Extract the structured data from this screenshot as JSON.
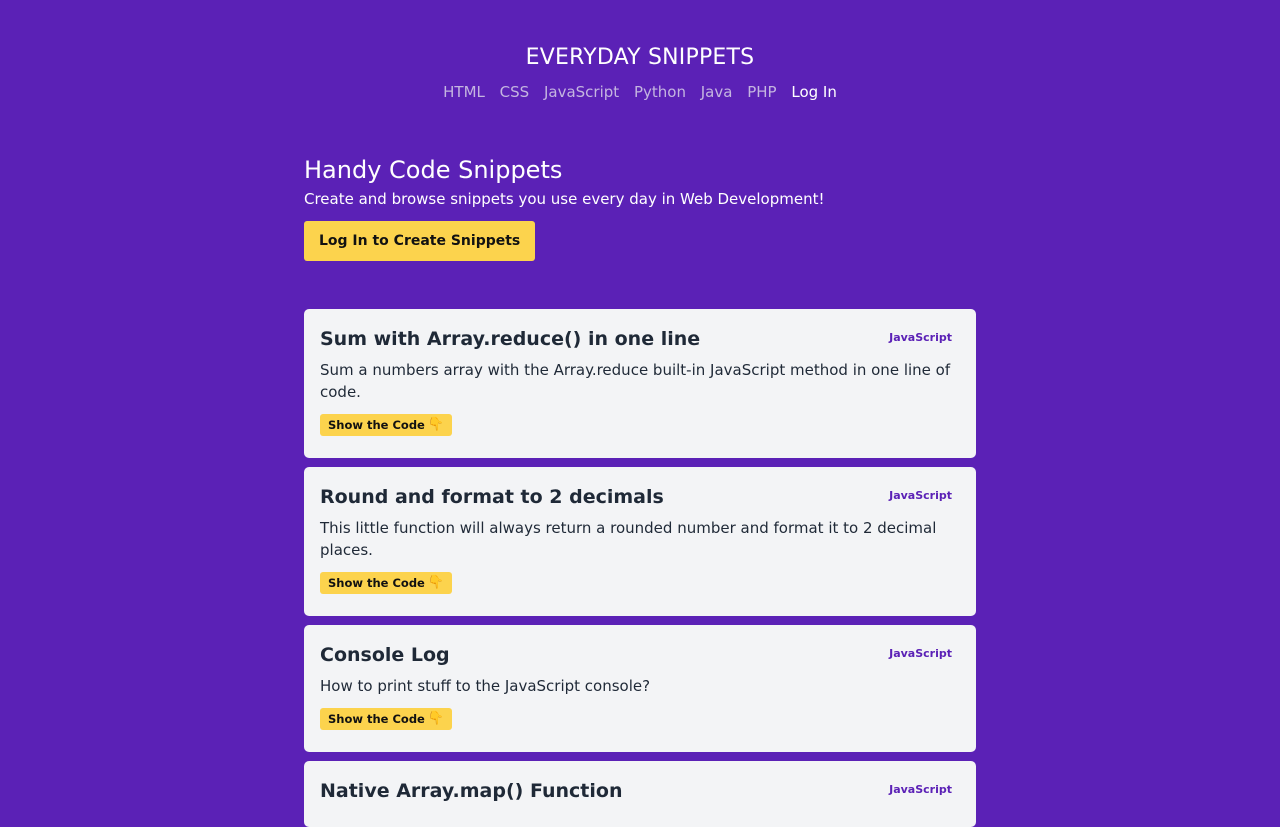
{
  "site": {
    "title": "EVERYDAY SNIPPETS"
  },
  "nav": {
    "items": [
      {
        "label": "HTML",
        "active": false
      },
      {
        "label": "CSS",
        "active": false
      },
      {
        "label": "JavaScript",
        "active": false
      },
      {
        "label": "Python",
        "active": false
      },
      {
        "label": "Java",
        "active": false
      },
      {
        "label": "PHP",
        "active": false
      },
      {
        "label": "Log In",
        "active": true
      }
    ]
  },
  "hero": {
    "heading": "Handy Code Snippets",
    "subheading": "Create and browse snippets you use every day in Web Development!",
    "cta_label": "Log In to Create Snippets"
  },
  "colors": {
    "background": "#5b21b6",
    "accent": "#fcd34d",
    "card": "#f3f4f6",
    "tag": "#5b21b6"
  },
  "snippets": [
    {
      "title": "Sum with Array.reduce() in one line",
      "tag": "JavaScript",
      "description": "Sum a numbers array with the Array.reduce built-in JavaScript method in one line of code.",
      "button_label": "Show the Code",
      "button_icon": "pointing-hand-icon"
    },
    {
      "title": "Round and format to 2 decimals",
      "tag": "JavaScript",
      "description": "This little function will always return a rounded number and format it to 2 decimal places.",
      "button_label": "Show the Code",
      "button_icon": "pointing-hand-icon"
    },
    {
      "title": "Console Log",
      "tag": "JavaScript",
      "description": "How to print stuff to the JavaScript console?",
      "button_label": "Show the Code",
      "button_icon": "pointing-hand-icon"
    },
    {
      "title": "Native Array.map() Function",
      "tag": "JavaScript",
      "description": "",
      "button_label": "",
      "button_icon": ""
    }
  ]
}
